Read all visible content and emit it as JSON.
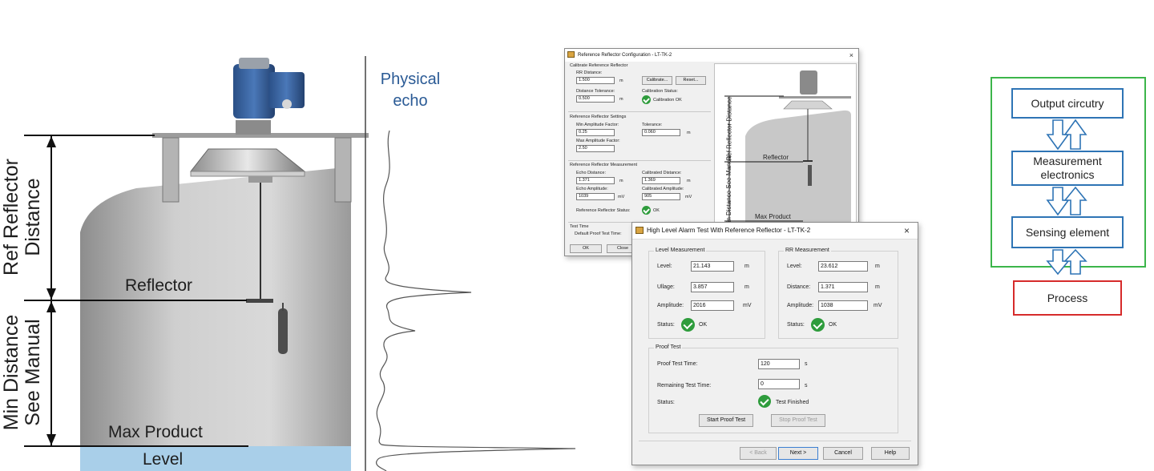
{
  "tank_diagram": {
    "ref_reflector_label": [
      "Ref Reflector",
      "Distance"
    ],
    "min_distance_label": [
      "Min Distance",
      "See Manual"
    ],
    "reflector_label": "Reflector",
    "max_product_label": "Max Product",
    "level_label": "Level"
  },
  "echo": {
    "title_line1": "Physical",
    "title_line2": "echo"
  },
  "config_dialog": {
    "title": "Reference Reflector Configuration - LT-TK-2",
    "close": "×",
    "calibrate_group": "Calibrate Reference Reflector",
    "rr_distance_label": "RR Distance:",
    "rr_distance_value": "1.500",
    "unit_m": "m",
    "calibrate_btn": "Calibrate...",
    "reset_btn": "Reset...",
    "distance_tolerance_label": "Distance Tolerance:",
    "distance_tolerance_value": "0.500",
    "calibration_status_label": "Calibration Status:",
    "calibration_status_value": "Calibration OK",
    "settings_group": "Reference Reflector Settings",
    "min_amp_label": "Min Amplitude Factor:",
    "min_amp_value": "0.25",
    "tolerance_label": "Tolerance:",
    "tolerance_value": "0.060",
    "max_amp_label": "Max Amplitude Factor:",
    "max_amp_value": "2.50",
    "measurement_group": "Reference Reflector Measurement",
    "echo_distance_label": "Echo Distance:",
    "echo_distance_value": "1.371",
    "calibrated_distance_label": "Calibrated Distance:",
    "calibrated_distance_value": "1.369",
    "echo_amplitude_label": "Echo Amplitude:",
    "echo_amplitude_value": "1039",
    "unit_mv": "mV",
    "calibrated_amplitude_label": "Calibrated Amplitude:",
    "calibrated_amplitude_value": "905",
    "rr_status_label": "Reference Reflector Status:",
    "rr_status_value": "OK",
    "test_time_label": "Test Time",
    "default_proof_label": "Default Proof Test Time:",
    "ok_btn": "OK",
    "close_btn": "Close",
    "illus_ref_reflector": "Ref Reflector Distance",
    "illus_reflector": "Reflector",
    "illus_min_distance": "Min Distance See Manual",
    "illus_max_product": "Max Product"
  },
  "alarm_dialog": {
    "title": "High Level Alarm Test With Reference Reflector - LT-TK-2",
    "close": "×",
    "level_group": "Level Measurement",
    "level_label": "Level:",
    "level_value": "21.143",
    "ullage_label": "Ullage:",
    "ullage_value": "3.857",
    "amplitude_label": "Amplitude:",
    "amplitude_value": "2016",
    "status_label": "Status:",
    "status_value": "OK",
    "unit_m": "m",
    "unit_mv": "mV",
    "rr_group": "RR Measurement",
    "rr_level_label": "Level:",
    "rr_level_value": "23.612",
    "rr_distance_label": "Distance:",
    "rr_distance_value": "1.371",
    "rr_amplitude_label": "Amplitude:",
    "rr_amplitude_value": "1038",
    "rr_status_label": "Status:",
    "rr_status_value": "OK",
    "proof_group": "Proof Test",
    "proof_time_label": "Proof Test Time:",
    "proof_time_value": "120",
    "unit_s": "s",
    "remaining_label": "Remaining Test Time:",
    "remaining_value": "0",
    "proof_status_label": "Status:",
    "proof_status_value": "Test Finished",
    "start_btn": "Start Proof Test",
    "stop_btn": "Stop Proof Test",
    "back_btn": "< Back",
    "next_btn": "Next >",
    "cancel_btn": "Cancel",
    "help_btn": "Help"
  },
  "block_diagram": {
    "output": "Output circutry",
    "measurement_line1": "Measurement",
    "measurement_line2": "electronics",
    "sensing": "Sensing element",
    "process": "Process",
    "colors": {
      "blue": "#2e74b5",
      "green": "#3cb54a",
      "red": "#d62b2b"
    }
  }
}
